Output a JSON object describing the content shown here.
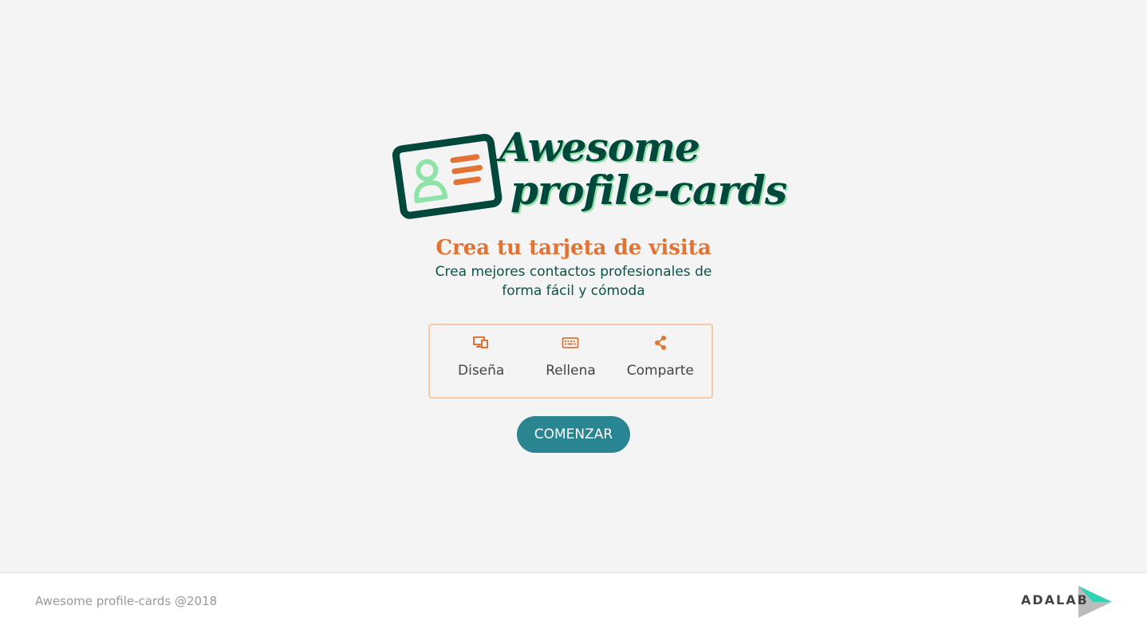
{
  "logo": {
    "line1": "Awesome",
    "line2": "profile-cards"
  },
  "hero": {
    "title": "Crea tu tarjeta de visita",
    "subtitle": "Crea mejores contactos profesionales de forma fácil y cómoda"
  },
  "steps": [
    {
      "label": "Diseña",
      "icon": "design-icon"
    },
    {
      "label": "Rellena",
      "icon": "keyboard-icon"
    },
    {
      "label": "Comparte",
      "icon": "share-icon"
    }
  ],
  "cta": {
    "label": "COMENZAR"
  },
  "footer": {
    "copyright": "Awesome profile-cards @2018",
    "brand": "ADALAB"
  },
  "colors": {
    "background": "#f4f4f4",
    "title_orange": "#e17334",
    "dark_green": "#00473c",
    "light_green": "#8fe3a8",
    "button_teal": "#2a8593",
    "steps_border": "#f4c9a8"
  }
}
